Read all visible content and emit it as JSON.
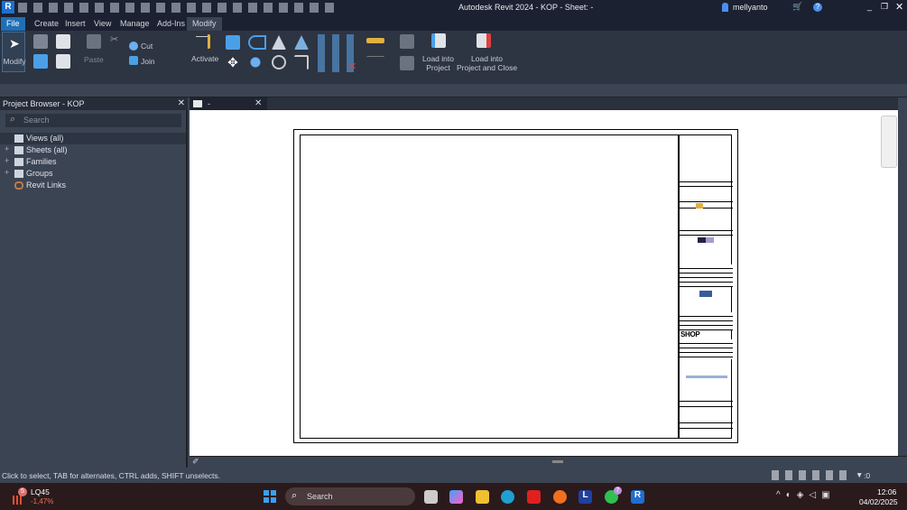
{
  "window": {
    "title": "Autodesk Revit 2024 - KOP - Sheet: -",
    "user": "mellyanto"
  },
  "ribbon_tabs": [
    "File",
    "Create",
    "Insert",
    "View",
    "Manage",
    "Add-Ins",
    "Modify"
  ],
  "ribbon": {
    "modify": "Modify",
    "paste": "Paste",
    "cut": "Cut",
    "join": "Join",
    "activate": "Activate",
    "load_into_project": [
      "Load into",
      "Project"
    ],
    "load_into_project_close": [
      "Load into",
      "Project and Close"
    ]
  },
  "project_browser": {
    "title": "Project Browser - KOP",
    "search_placeholder": "Search",
    "items": [
      {
        "label": "Views (all)",
        "expandable": false
      },
      {
        "label": "Sheets (all)",
        "expandable": true
      },
      {
        "label": "Families",
        "expandable": true
      },
      {
        "label": "Groups",
        "expandable": true
      },
      {
        "label": "Revit Links",
        "expandable": false
      }
    ]
  },
  "view_tab": {
    "label": "-"
  },
  "sheet": {
    "title_block_stamp": "SHOP DRAWING"
  },
  "status_bar": {
    "message": "Click to select, TAB for alternates, CTRL adds, SHIFT unselects.",
    "filter_count": ":0"
  },
  "taskbar": {
    "stock_name": "LQ45",
    "stock_change": "-1,47%",
    "stock_badge": "5",
    "search": "Search",
    "whatsapp_badge": "7",
    "time": "12:06",
    "date": "04/02/2025"
  }
}
